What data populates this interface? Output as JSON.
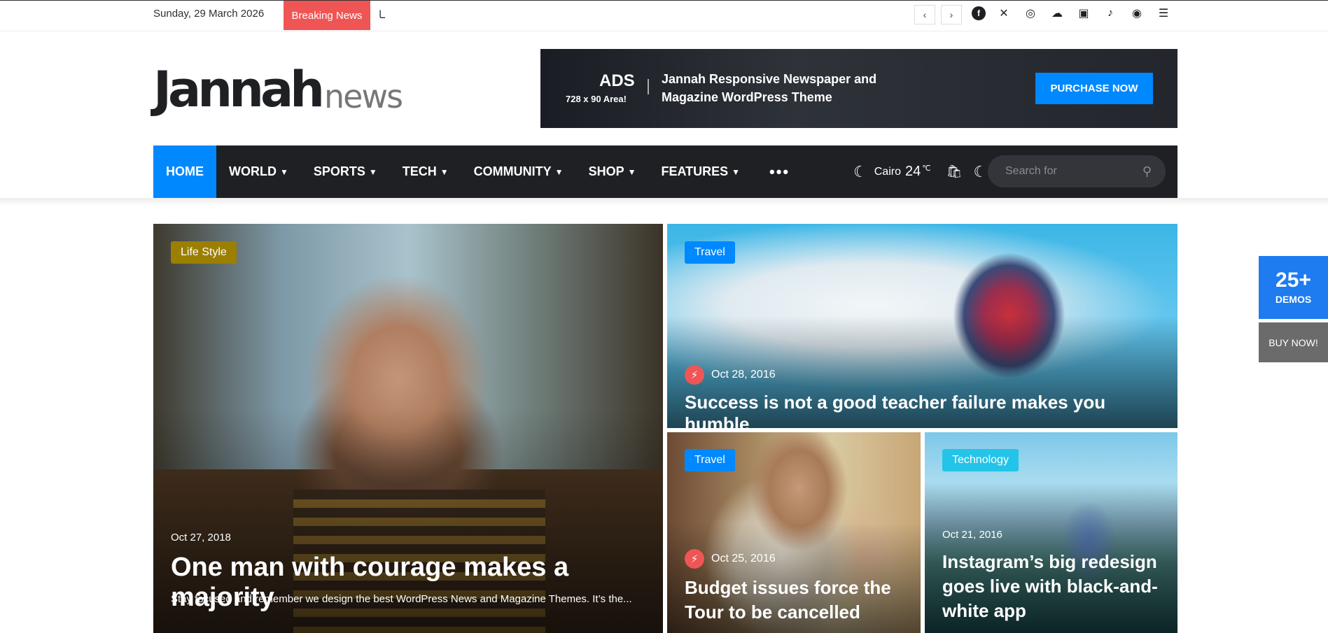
{
  "topbar": {
    "date": "Sunday, 29 March 2026",
    "breaking_label": "Breaking News",
    "ticker_text": "ـا",
    "prev_arrow": "‹",
    "next_arrow": "›",
    "social_icons": [
      "facebook-icon",
      "x-icon",
      "dribbble-icon",
      "soundcloud-icon",
      "instagram-icon",
      "tiktok-icon",
      "user-icon",
      "menu-icon"
    ]
  },
  "header": {
    "logo_main": "Jannah",
    "logo_sub": "news",
    "ad": {
      "title": "ADS",
      "size": "728 x 90 Area!",
      "text_line1": "Jannah Responsive Newspaper and",
      "text_line2": "Magazine WordPress Theme",
      "button": "PURCHASE NOW"
    }
  },
  "nav": {
    "items": [
      {
        "label": "HOME"
      },
      {
        "label": "WORLD"
      },
      {
        "label": "SPORTS"
      },
      {
        "label": "TECH"
      },
      {
        "label": "COMMUNITY"
      },
      {
        "label": "SHOP"
      },
      {
        "label": "FEATURES"
      }
    ],
    "more": "•••",
    "weather": {
      "city": "Cairo",
      "temp": "24",
      "unit": "℃"
    },
    "search_placeholder": "Search for"
  },
  "cards": [
    {
      "tag": "Life Style",
      "tag_color": "#9b7f00",
      "date": "Oct 27, 2018",
      "title": "One man with courage makes a majority",
      "excerpt": "Stay focused and remember we design the best WordPress News and Magazine Themes. It’s the..."
    },
    {
      "tag": "Travel",
      "tag_color": "#0088ff",
      "date": "Oct 28, 2016",
      "title": "Success is not a good teacher failure makes you humble"
    },
    {
      "tag": "Travel",
      "tag_color": "#0088ff",
      "date": "Oct 25, 2016",
      "title_line1": "Budget issues force the",
      "title_line2": "Tour to be cancelled"
    },
    {
      "tag": "Technology",
      "tag_color": "#23c4e8",
      "date": "Oct 21, 2016",
      "title_line1": "Instagram’s big redesign",
      "title_line2": "goes live with black-and-",
      "title_line3": "white app"
    }
  ],
  "side": {
    "demos_count": "25+",
    "demos_label": "DEMOS",
    "buy_now": "BUY NOW!"
  },
  "colors": {
    "accent": "#0088ff",
    "breaking": "#f05555",
    "nav_bg": "#1f2024"
  }
}
